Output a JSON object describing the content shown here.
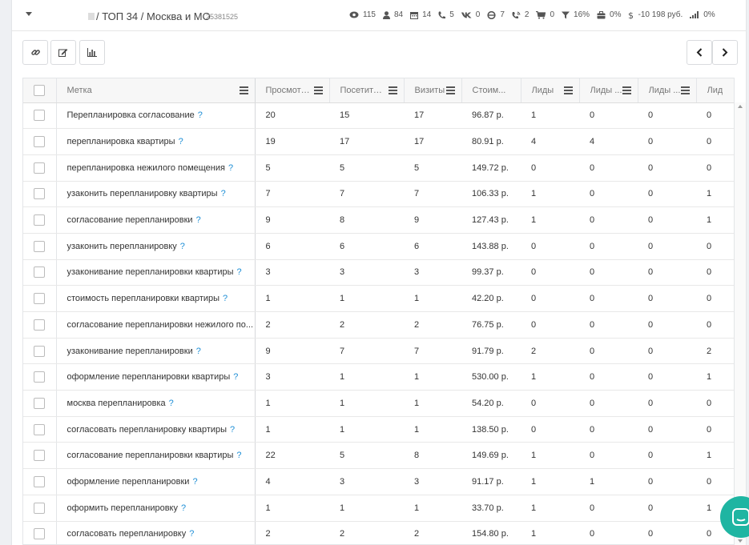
{
  "header": {
    "breadcrumb": "/ ТОП 34 / Москва и МО",
    "project_id": "25381525"
  },
  "stats": [
    {
      "icon": "eye-icon",
      "value": "115"
    },
    {
      "icon": "user-icon",
      "value": "84"
    },
    {
      "icon": "calendar-icon",
      "value": "14"
    },
    {
      "icon": "phone-icon",
      "value": "5"
    },
    {
      "icon": "vk-icon",
      "value": "0"
    },
    {
      "icon": "internet-explorer-icon",
      "value": "7"
    },
    {
      "icon": "phone-call-icon",
      "value": "2"
    },
    {
      "icon": "cart-icon",
      "value": "0"
    },
    {
      "icon": "filter-icon",
      "value": "16%"
    },
    {
      "icon": "briefcase-icon",
      "value": "0%"
    },
    {
      "icon": "dollar-icon",
      "value": "-10 198 руб."
    },
    {
      "icon": "signal-icon",
      "value": "0%"
    }
  ],
  "toolbar": {
    "buttons": [
      "link-icon",
      "edit-icon",
      "bar-chart-icon"
    ],
    "prev": "chevron-left-icon",
    "next": "chevron-right-icon"
  },
  "table": {
    "columns": [
      "Метка",
      "Просмотры",
      "Посетители",
      "Визиты",
      "Стоим...",
      "Лиды",
      "Лиды ...",
      "Лиды ...",
      "Лид"
    ],
    "rows": [
      [
        "Перепланировка согласование",
        "20",
        "15",
        "17",
        "96.87 р.",
        "1",
        "0",
        "0",
        "0"
      ],
      [
        "перепланировка квартиры",
        "19",
        "17",
        "17",
        "80.91 р.",
        "4",
        "4",
        "0",
        "0"
      ],
      [
        "перепланировка нежилого помещения",
        "5",
        "5",
        "5",
        "149.72 р.",
        "0",
        "0",
        "0",
        "0"
      ],
      [
        "узаконить перепланировку квартиры",
        "7",
        "7",
        "7",
        "106.33 р.",
        "1",
        "0",
        "0",
        "1"
      ],
      [
        "согласование перепланировки",
        "9",
        "8",
        "9",
        "127.43 р.",
        "1",
        "0",
        "0",
        "1"
      ],
      [
        "узаконить перепланировку",
        "6",
        "6",
        "6",
        "143.88 р.",
        "0",
        "0",
        "0",
        "0"
      ],
      [
        "узаконивание перепланировки квартиры",
        "3",
        "3",
        "3",
        "99.37 р.",
        "0",
        "0",
        "0",
        "0"
      ],
      [
        "стоимость перепланировки квартиры",
        "1",
        "1",
        "1",
        "42.20 р.",
        "0",
        "0",
        "0",
        "0"
      ],
      [
        "согласование перепланировки нежилого по...",
        "2",
        "2",
        "2",
        "76.75 р.",
        "0",
        "0",
        "0",
        "0"
      ],
      [
        "узаконивание перепланировки",
        "9",
        "7",
        "7",
        "91.79 р.",
        "2",
        "0",
        "0",
        "2"
      ],
      [
        "оформление перепланировки квартиры",
        "3",
        "1",
        "1",
        "530.00 р.",
        "1",
        "0",
        "0",
        "1"
      ],
      [
        "москва перепланировка",
        "1",
        "1",
        "1",
        "54.20 р.",
        "0",
        "0",
        "0",
        "0"
      ],
      [
        "согласовать перепланировку квартиры",
        "1",
        "1",
        "1",
        "138.50 р.",
        "0",
        "0",
        "0",
        "0"
      ],
      [
        "согласование перепланировки квартиры",
        "22",
        "5",
        "8",
        "149.69 р.",
        "1",
        "0",
        "0",
        "1"
      ],
      [
        "оформление перепланировки",
        "4",
        "3",
        "3",
        "91.17 р.",
        "1",
        "1",
        "0",
        "0"
      ],
      [
        "оформить перепланировку",
        "1",
        "1",
        "1",
        "33.70 р.",
        "1",
        "0",
        "0",
        "1"
      ],
      [
        "согласовать перепланировку",
        "2",
        "2",
        "2",
        "154.80 р.",
        "1",
        "0",
        "0",
        "0"
      ]
    ],
    "help_mark": "?"
  },
  "colors": {
    "accent": "#1f8fd6",
    "chat": "#1fb5a2"
  }
}
